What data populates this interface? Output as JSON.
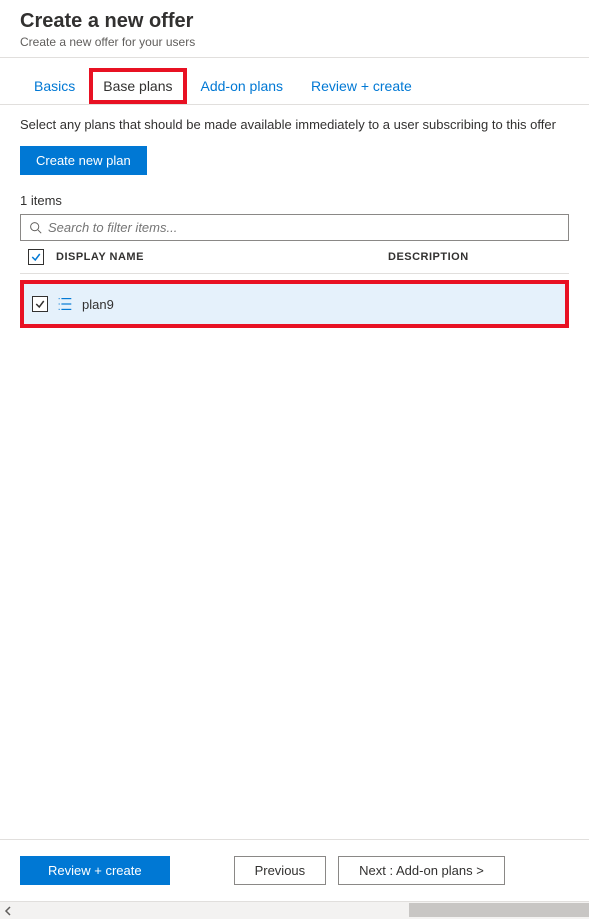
{
  "header": {
    "title": "Create a new offer",
    "subtitle": "Create a new offer for your users"
  },
  "tabs": {
    "basics": "Basics",
    "base_plans": "Base plans",
    "addon_plans": "Add-on plans",
    "review_create": "Review + create"
  },
  "content": {
    "description": "Select any plans that should be made available immediately to a user subscribing to this offer",
    "create_new_plan": "Create new plan",
    "items_count": "1 items",
    "search_placeholder": "Search to filter items..."
  },
  "table": {
    "col_name": "DISPLAY NAME",
    "col_desc": "DESCRIPTION",
    "rows": [
      {
        "name": "plan9",
        "description": ""
      }
    ]
  },
  "footer": {
    "review_create": "Review + create",
    "previous": "Previous",
    "next": "Next : Add-on plans >"
  }
}
